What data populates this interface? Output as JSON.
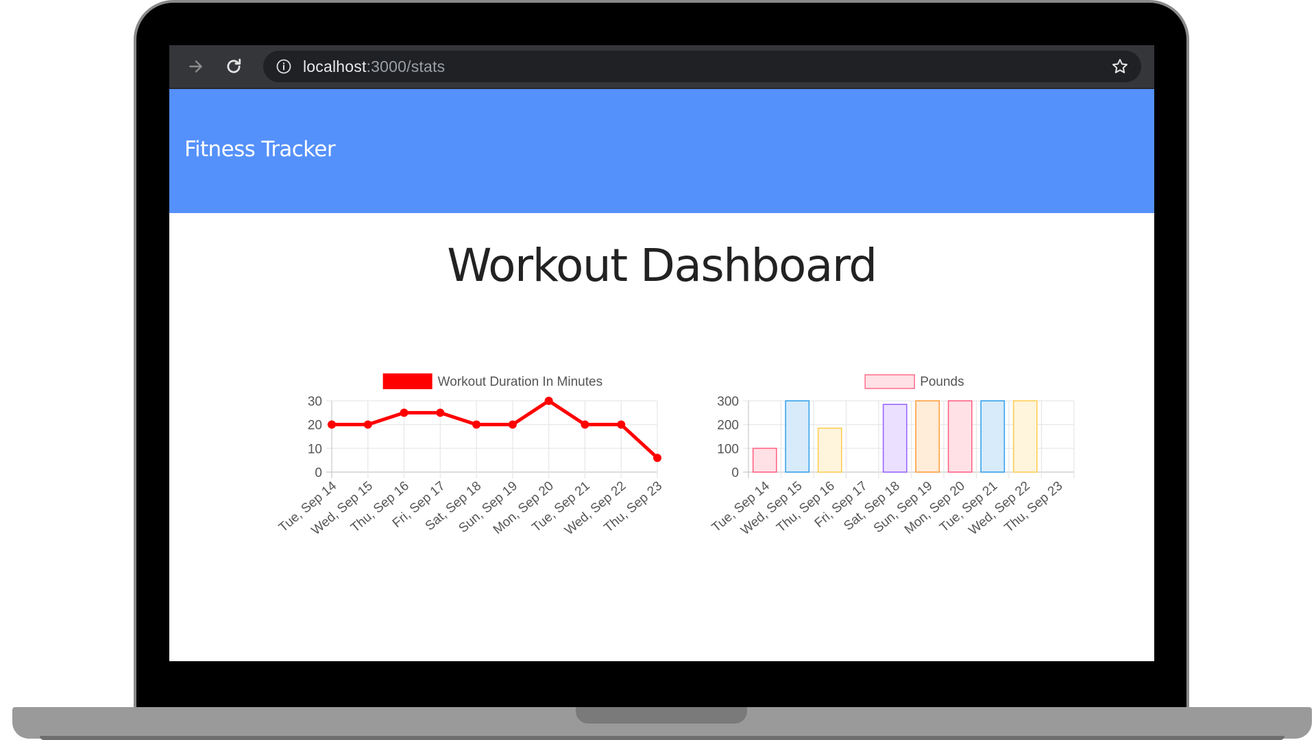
{
  "browser": {
    "url_host": "localhost",
    "url_path": ":3000/stats"
  },
  "app": {
    "brand": "Fitness Tracker",
    "page_title": "Workout Dashboard"
  },
  "chart_data": [
    {
      "type": "line",
      "title": "",
      "legend": "Workout Duration In Minutes",
      "legend_position": "top",
      "color": "#ff0000",
      "categories": [
        "Tue, Sep 14",
        "Wed, Sep 15",
        "Thu, Sep 16",
        "Fri, Sep 17",
        "Sat, Sep 18",
        "Sun, Sep 19",
        "Mon, Sep 20",
        "Tue, Sep 21",
        "Wed, Sep 22",
        "Thu, Sep 23"
      ],
      "values": [
        20,
        20,
        25,
        25,
        20,
        20,
        30,
        20,
        20,
        6
      ],
      "ylim": [
        0,
        30
      ],
      "yticks": [
        0,
        10,
        20,
        30
      ],
      "grid": true
    },
    {
      "type": "bar",
      "title": "",
      "legend": "Pounds",
      "legend_position": "top",
      "categories": [
        "Tue, Sep 14",
        "Wed, Sep 15",
        "Thu, Sep 16",
        "Fri, Sep 17",
        "Sat, Sep 18",
        "Sun, Sep 19",
        "Mon, Sep 20",
        "Tue, Sep 21",
        "Wed, Sep 22",
        "Thu, Sep 23"
      ],
      "values": [
        100,
        300,
        185,
        0,
        285,
        300,
        300,
        300,
        300,
        0
      ],
      "bar_colors": [
        {
          "fill": "#ffe1e6",
          "stroke": "#ff6384"
        },
        {
          "fill": "#d7ebfa",
          "stroke": "#36a2eb"
        },
        {
          "fill": "#fff4dc",
          "stroke": "#ffce56"
        },
        {
          "fill": "#dbf2f2",
          "stroke": "#4bc0c0"
        },
        {
          "fill": "#ebe0ff",
          "stroke": "#9966ff"
        },
        {
          "fill": "#ffecd9",
          "stroke": "#ff9f40"
        },
        {
          "fill": "#ffe1e6",
          "stroke": "#ff6384"
        },
        {
          "fill": "#d7ebfa",
          "stroke": "#36a2eb"
        },
        {
          "fill": "#fff4dc",
          "stroke": "#ffce56"
        },
        {
          "fill": "#dbf2f2",
          "stroke": "#4bc0c0"
        }
      ],
      "legend_fill": "#ffe1e6",
      "legend_stroke": "#ff6384",
      "ylim": [
        0,
        300
      ],
      "yticks": [
        0,
        100,
        200,
        300
      ],
      "grid": true
    }
  ]
}
